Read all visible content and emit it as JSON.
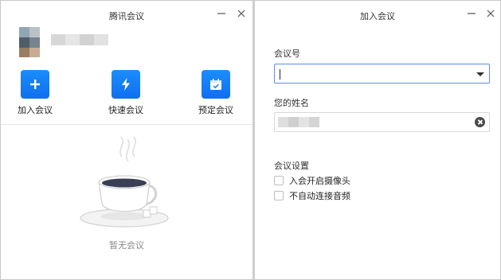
{
  "left_window": {
    "title": "腾讯会议",
    "actions": [
      {
        "label": "加入会议",
        "icon": "plus-icon"
      },
      {
        "label": "快速会议",
        "icon": "lightning-icon"
      },
      {
        "label": "预定会议",
        "icon": "calendar-icon"
      }
    ],
    "empty_text": "暂无会议"
  },
  "right_window": {
    "title": "加入会议",
    "meeting_id_label": "会议号",
    "meeting_id_value": "",
    "name_label": "您的姓名",
    "settings_label": "会议设置",
    "options": [
      {
        "label": "入会开启摄像头",
        "checked": false
      },
      {
        "label": "不自动连接音频",
        "checked": false
      }
    ]
  },
  "colors": {
    "accent": "#1a7ef8",
    "field_focus": "#5b8de8"
  }
}
